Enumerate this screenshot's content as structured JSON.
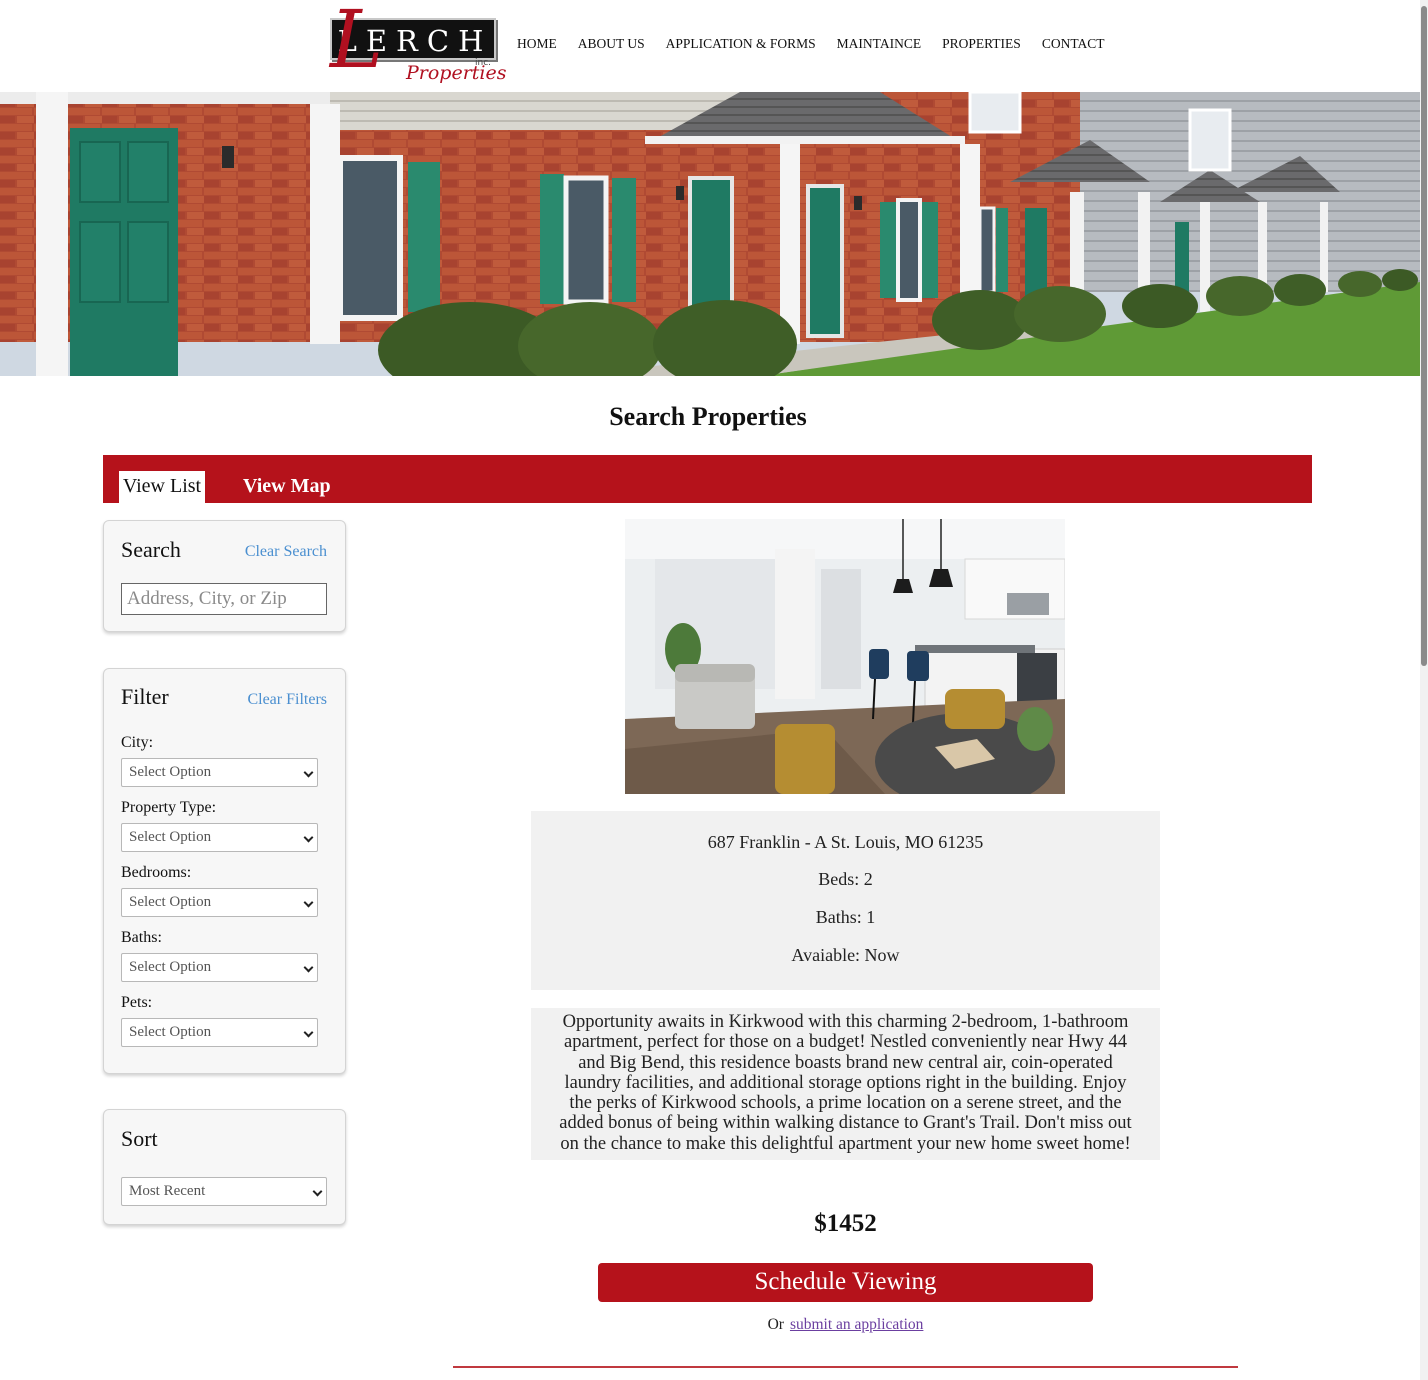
{
  "brand": {
    "logo_word": "LERCH",
    "logo_inc": "inc.",
    "logo_sub": "Properties",
    "accent_color": "#b5121b",
    "link_color": "#4a8fd0"
  },
  "nav": {
    "items": [
      "HOME",
      "ABOUT US",
      "APPLICATION & FORMS",
      "MAINTAINCE",
      "PROPERTIES",
      "CONTACT"
    ]
  },
  "hero": {
    "image": "brick townhouse row with green doors and shrubs"
  },
  "page": {
    "title": "Search Properties"
  },
  "tabs": {
    "list_label": "View List",
    "map_label": "View Map",
    "active": "View List"
  },
  "search": {
    "title": "Search",
    "clear_label": "Clear Search",
    "placeholder": "Address, City, or Zip",
    "value": ""
  },
  "filter": {
    "title": "Filter",
    "clear_label": "Clear Filters",
    "fields": [
      {
        "label": "City:",
        "value": "Select Option"
      },
      {
        "label": "Property Type:",
        "value": "Select Option"
      },
      {
        "label": "Bedrooms:",
        "value": "Select Option"
      },
      {
        "label": "Baths:",
        "value": "Select Option"
      },
      {
        "label": "Pets:",
        "value": "Select Option"
      }
    ]
  },
  "sort": {
    "title": "Sort",
    "value": "Most Recent"
  },
  "listing": {
    "image": "modern open living room and white kitchen interior",
    "address": "687 Franklin - A St. Louis, MO 61235",
    "beds": "Beds: 2",
    "baths": "Baths: 1",
    "available": "Avaiable: Now",
    "description_lines": [
      "Opportunity awaits in Kirkwood with this charming 2-bedroom, 1-bathroom",
      "apartment, perfect for those on a budget! Nestled conveniently near Hwy 44",
      "and Big Bend, this residence boasts brand new central air, coin-operated",
      "laundry facilities, and additional storage options right in the building. Enjoy",
      "the perks of Kirkwood schools, a prime location on a serene street, and the",
      "added bonus of being within walking distance to Grant's Trail. Don't miss out",
      "on the chance to make this delightful apartment your new home sweet home!"
    ],
    "price": "$1452",
    "schedule_label": "Schedule Viewing",
    "or_text": "Or",
    "apply_link": "submit an application"
  }
}
